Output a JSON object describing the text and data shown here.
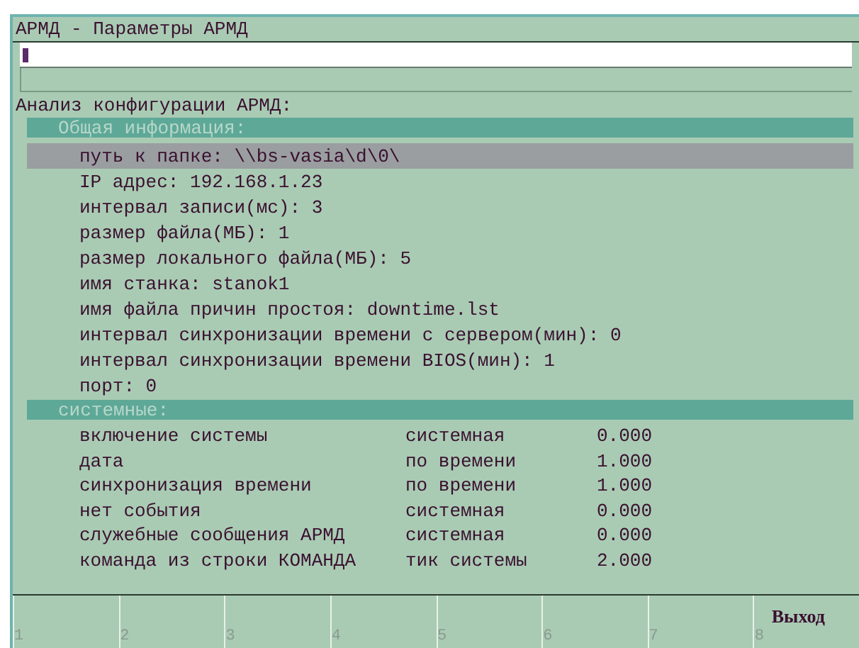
{
  "window": {
    "title": "АРМД - Параметры АРМД"
  },
  "heading": "Анализ конфигурации АРМД:",
  "general": {
    "title": "Общая информация:",
    "items": [
      {
        "text": "путь к папке: \\\\bs-vasia\\d\\0\\",
        "selected": true
      },
      {
        "text": "IP адрес: 192.168.1.23",
        "selected": false
      },
      {
        "text": "интервал записи(мс): 3",
        "selected": false
      },
      {
        "text": "размер файла(МБ): 1",
        "selected": false
      },
      {
        "text": "размер локального файла(МБ): 5",
        "selected": false
      },
      {
        "text": "имя станка: stanok1",
        "selected": false
      },
      {
        "text": "имя файла причин простоя: downtime.lst",
        "selected": false
      },
      {
        "text": "интервал синхронизации времени с сервером(мин): 0",
        "selected": false
      },
      {
        "text": "интервал синхронизации времени BIOS(мин): 1",
        "selected": false
      },
      {
        "text": "порт: 0",
        "selected": false
      }
    ]
  },
  "system": {
    "title": "системные:",
    "rows": [
      {
        "name": "включение системы",
        "type": "системная",
        "value": "0.000"
      },
      {
        "name": "дата",
        "type": "по времени",
        "value": "1.000"
      },
      {
        "name": "синхронизация времени",
        "type": "по времени",
        "value": "1.000"
      },
      {
        "name": "нет события",
        "type": "системная",
        "value": "0.000"
      },
      {
        "name": "служебные сообщения АРМД",
        "type": "системная",
        "value": "0.000"
      },
      {
        "name": "команда из строки КОМАНДА",
        "type": "тик системы",
        "value": "2.000"
      }
    ]
  },
  "function_keys": [
    {
      "number": "1"
    },
    {
      "number": "2"
    },
    {
      "number": "3"
    },
    {
      "number": "4"
    },
    {
      "number": "5"
    },
    {
      "number": "6"
    },
    {
      "number": "7"
    },
    {
      "number": "8",
      "label": "Выход"
    }
  ]
}
